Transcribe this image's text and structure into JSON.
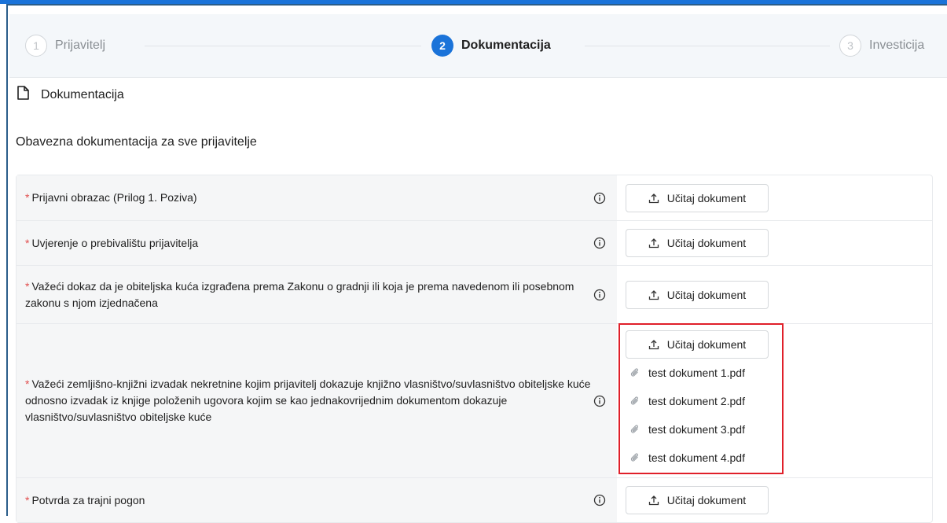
{
  "steps": [
    {
      "number": "1",
      "label": "Prijavitelj",
      "state": "inactive"
    },
    {
      "number": "2",
      "label": "Dokumentacija",
      "state": "active"
    },
    {
      "number": "3",
      "label": "Investicija",
      "state": "inactive"
    }
  ],
  "section": {
    "title": "Dokumentacija",
    "subtitle": "Obavezna dokumentacija za sve prijavitelje"
  },
  "upload_label": "Učitaj dokument",
  "required_marker": "*",
  "documents": [
    {
      "label": "Prijavni obrazac (Prilog 1. Poziva)"
    },
    {
      "label": "Uvjerenje o prebivalištu prijavitelja"
    },
    {
      "label": "Važeći dokaz da je obiteljska kuća izgrađena prema Zakonu o gradnji ili koja je prema navedenom ili posebnom zakonu s njom izjednačena"
    },
    {
      "label": "Važeći zemljišno-knjižni izvadak nekretnine kojim prijavitelj dokazuje knjižno vlasništvo/suvlasništvo obiteljske kuće odnosno izvadak iz knjige položenih ugovora kojim se kao jednakovrijednim dokumentom dokazuje vlasništvo/suvlasništvo obiteljske kuće",
      "files": [
        "test dokument 1.pdf",
        "test dokument 2.pdf",
        "test dokument 3.pdf",
        "test dokument 4.pdf"
      ]
    },
    {
      "label": "Potvrda za trajni pogon"
    }
  ],
  "colors": {
    "accent": "#1a73d9",
    "required": "#e14d4d",
    "highlight": "#e0202a"
  }
}
